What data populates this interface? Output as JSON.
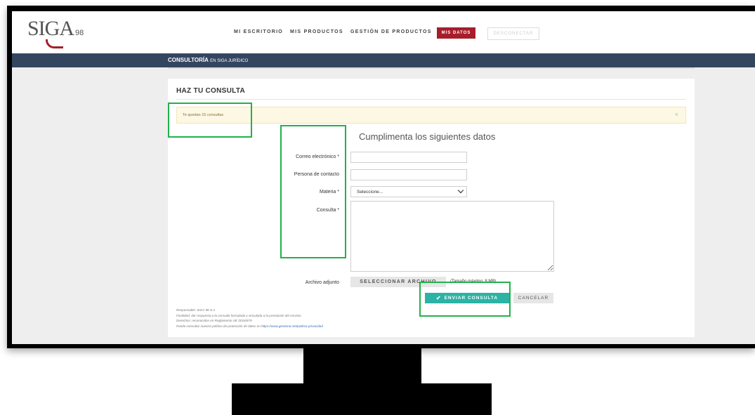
{
  "brand": {
    "name": "SIGA",
    "suffix": "98"
  },
  "nav": {
    "items": [
      "MI ESCRITORIO",
      "MIS PRODUCTOS",
      "GESTIÓN DE PRODUCTOS"
    ],
    "active": "MIS DATOS",
    "logout": "DESCONECTAR"
  },
  "subheader": {
    "title_bold": "CONSULTORÍA",
    "title_rest": "EN SIGA JURÍDICO"
  },
  "card": {
    "title": "HAZ TU CONSULTA",
    "alert": {
      "text": "Te quedan 15 consultas",
      "close": "×"
    },
    "form_heading": "Cumplimenta los siguientes datos"
  },
  "form": {
    "email_label": "Correo electrónico *",
    "contact_label": "Persona de contacto",
    "materia_label": "Materia *",
    "materia_value": "Seleccione...",
    "consulta_label": "Consulta *",
    "file_label": "Archivo adjunto",
    "file_button": "SELECCIONAR ARCHIVO",
    "file_hint": "(Tamaño máximo: 8 MB)",
    "submit": "ENVIAR CONSULTA",
    "cancel": "CANCELAR"
  },
  "footer": {
    "line1": "Responsable: SIGA 98 S.A",
    "line2": "Finalidad: dar respuesta a la consulta formulada y vinculada a la prestación del servicio",
    "line3": "Derechos: reconocidos en Reglamento UE 2016/679",
    "line4_text": "Puede consultar nuestra política de protección de datos en",
    "line4_link": "https://www.gestiona.net/politica-privacidad"
  },
  "colors": {
    "brand_red": "#a71d2a",
    "nav_blue": "#344560",
    "teal": "#2bb3a5",
    "highlight_green": "#22b14c"
  }
}
